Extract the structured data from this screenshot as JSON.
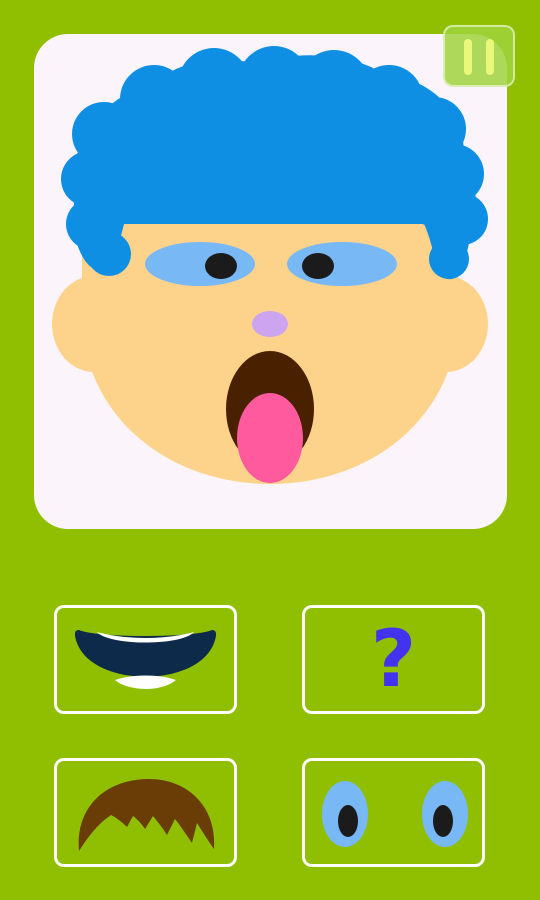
{
  "app": {
    "background_color": "#8fbf00",
    "canvas_color": "#fbf5fb"
  },
  "face": {
    "skin_color": "#fdd38b",
    "hair_color": "#0f8fe3",
    "eye_white_color": "#78b9f5",
    "pupil_color": "#1b1b1b",
    "nose_color": "#cda4f0",
    "mouth_color": "#4a2100",
    "tongue_color": "#ff5a9e"
  },
  "controls": {
    "pause_icon": "pause-icon",
    "tiles": [
      {
        "id": "mouth",
        "icon": "mouth-icon"
      },
      {
        "id": "random",
        "icon": "question-mark-icon",
        "symbol": "?"
      },
      {
        "id": "hair",
        "icon": "hair-icon"
      },
      {
        "id": "eyes",
        "icon": "eyes-icon"
      }
    ]
  }
}
